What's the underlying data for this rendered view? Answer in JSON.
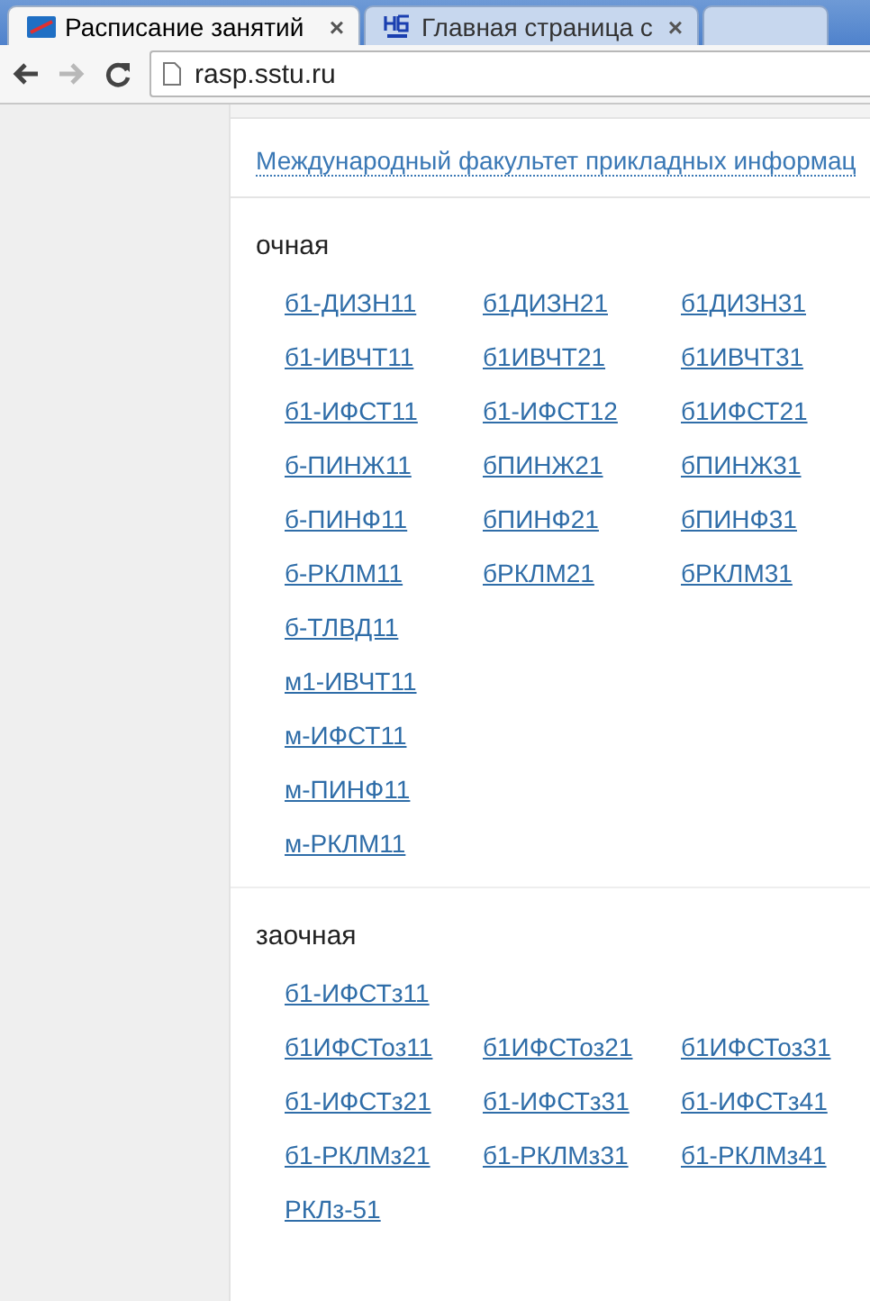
{
  "browser": {
    "tabs": [
      {
        "title": "Расписание занятий",
        "close": "×",
        "selected": true
      },
      {
        "title": "Главная страница с",
        "close": "×",
        "selected": false
      },
      {
        "selected": false
      }
    ],
    "address": "rasp.sstu.ru"
  },
  "faculty_link": "Международный факультет прикладных информац",
  "sections": [
    {
      "title": "очная",
      "rows": [
        [
          "б1-ДИЗН11",
          "б1ДИЗН21",
          "б1ДИЗН31"
        ],
        [
          "б1-ИВЧТ11",
          "б1ИВЧТ21",
          "б1ИВЧТ31"
        ],
        [
          "б1-ИФСТ11",
          "б1-ИФСТ12",
          "б1ИФСТ21"
        ],
        [
          "б-ПИНЖ11",
          "бПИНЖ21",
          "бПИНЖ31"
        ],
        [
          "б-ПИНФ11",
          "бПИНФ21",
          "бПИНФ31"
        ],
        [
          "б-РКЛМ11",
          "бРКЛМ21",
          "бРКЛМ31"
        ],
        [
          "б-ТЛВД11"
        ],
        [
          "м1-ИВЧТ11"
        ],
        [
          "м-ИФСТ11"
        ],
        [
          "м-ПИНФ11"
        ],
        [
          "м-РКЛМ11"
        ]
      ]
    },
    {
      "title": "заочная",
      "rows": [
        [
          "б1-ИФСТз11"
        ],
        [
          "б1ИФСТоз11",
          "б1ИФСТоз21",
          "б1ИФСТоз31"
        ],
        [
          "б1-ИФСТз21",
          "б1-ИФСТз31",
          "б1-ИФСТз41"
        ],
        [
          "б1-РКЛМз21",
          "б1-РКЛМз31",
          "б1-РКЛМз41"
        ],
        [
          "РКЛз-51"
        ]
      ]
    }
  ]
}
